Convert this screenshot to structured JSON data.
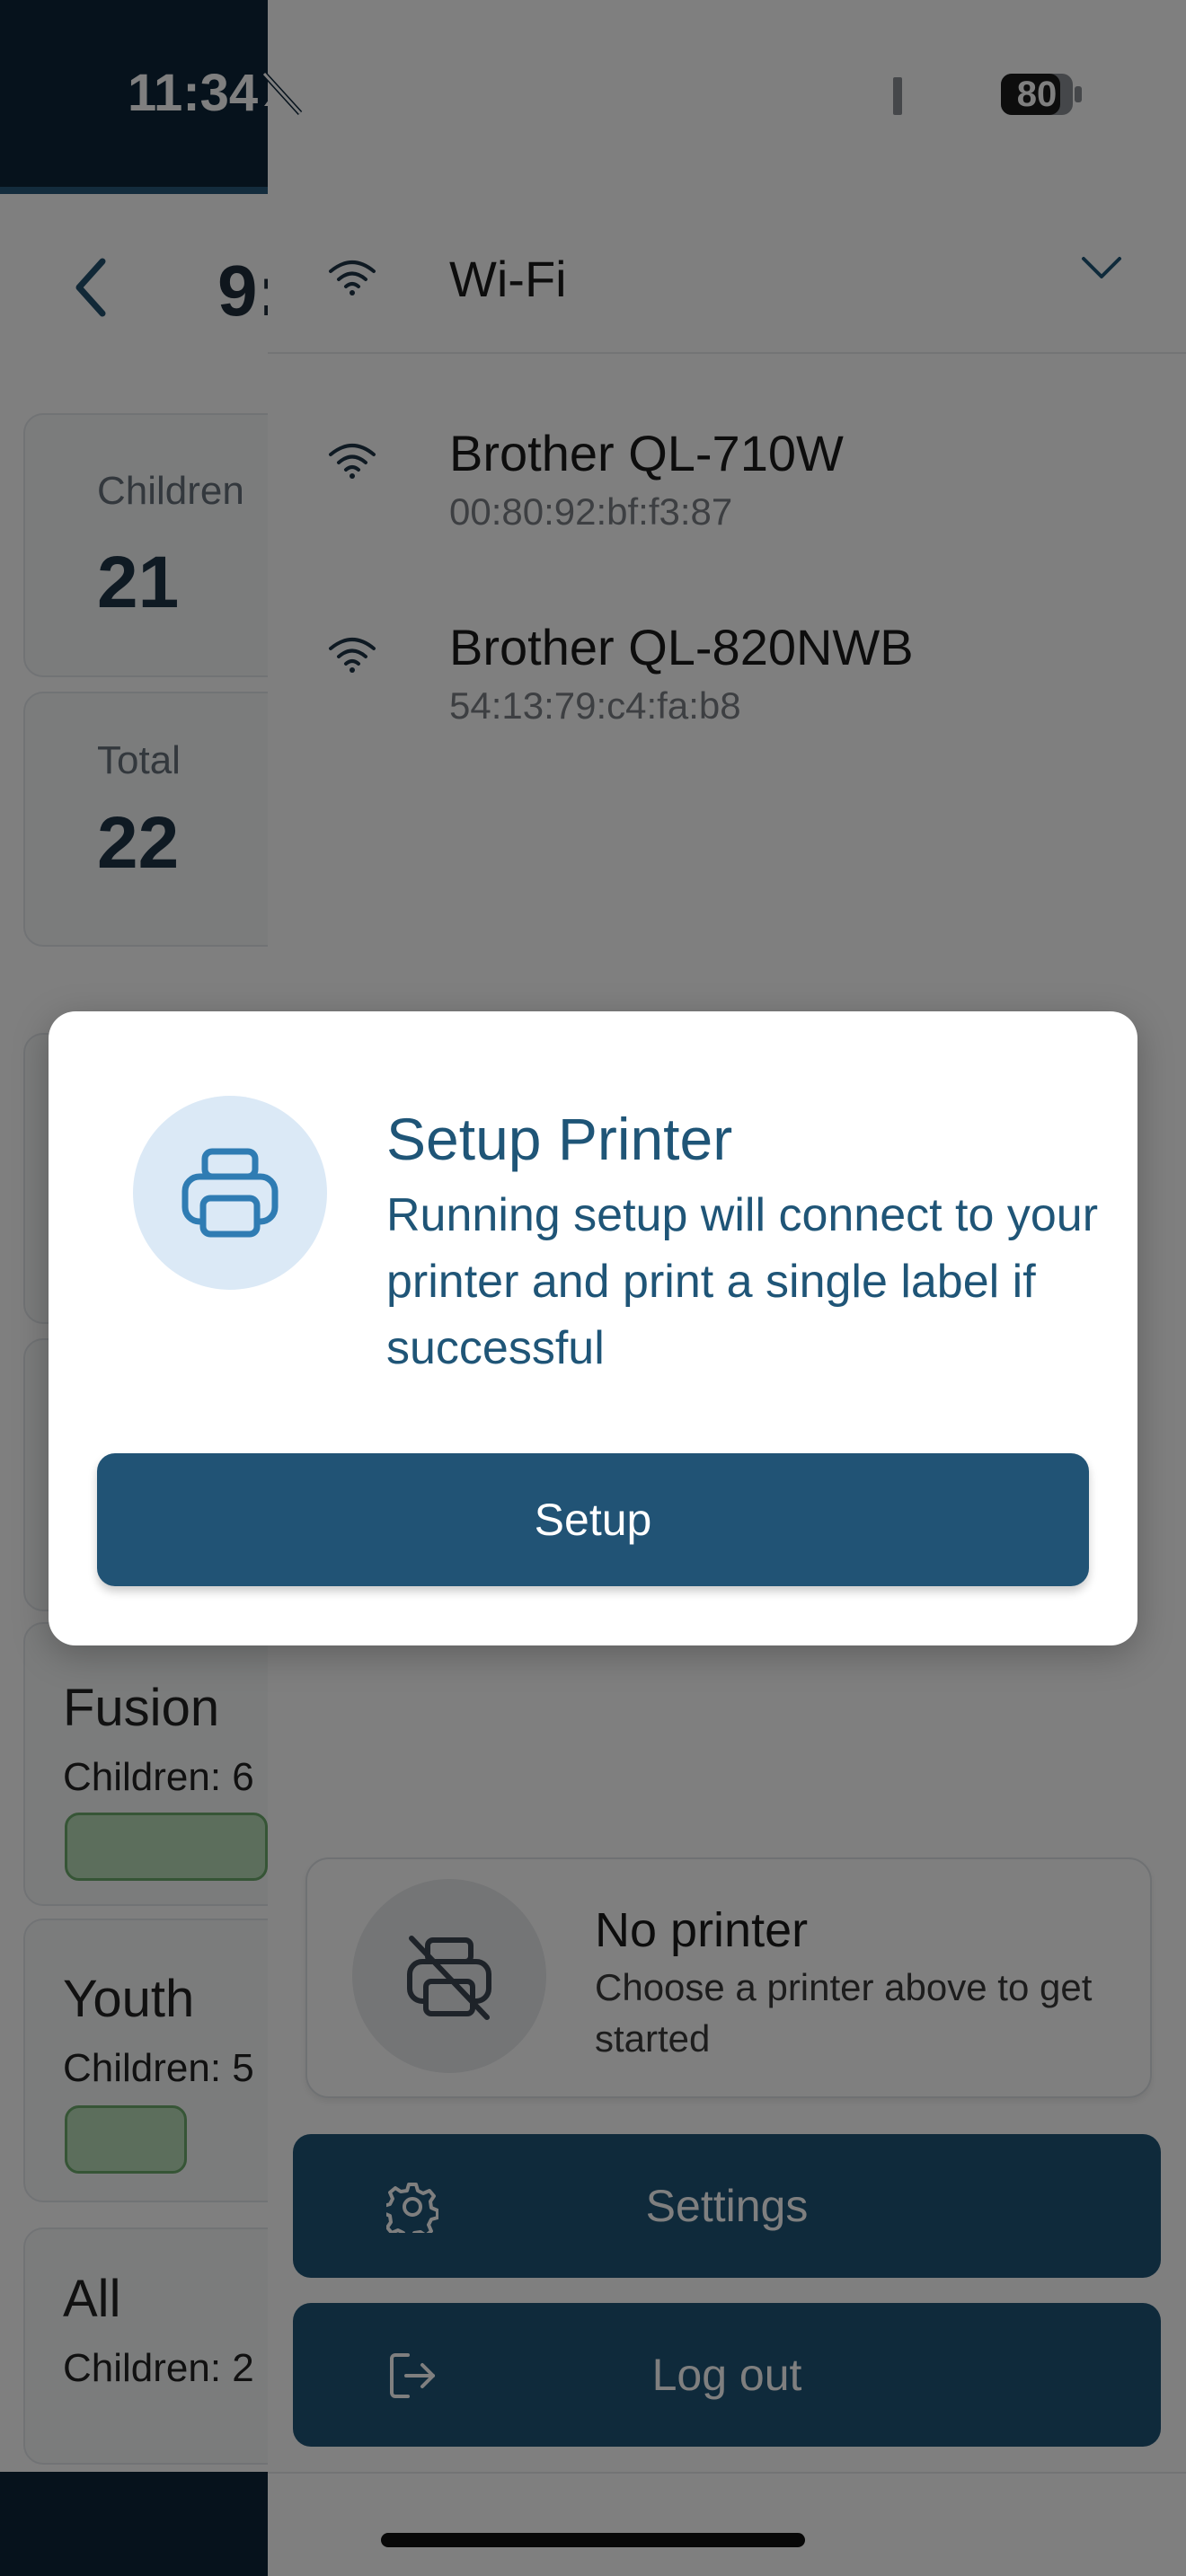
{
  "status_bar": {
    "time": "11:34",
    "battery": "80"
  },
  "background": {
    "title_partial": "9:",
    "cards": [
      {
        "label": "Children",
        "value": "21"
      },
      {
        "label": "Total",
        "value": "22"
      }
    ],
    "groups": [
      {
        "title": "Fusion",
        "subtitle": "Children: 6"
      },
      {
        "title": "Youth",
        "subtitle": "Children: 5"
      },
      {
        "title": "All",
        "subtitle": "Children: 2"
      }
    ]
  },
  "drawer": {
    "connection_label": "Wi-Fi",
    "printers": [
      {
        "name": "Brother QL-710W",
        "mac": "00:80:92:bf:f3:87"
      },
      {
        "name": "Brother QL-820NWB",
        "mac": "54:13:79:c4:fa:b8"
      }
    ],
    "no_printer": {
      "title": "No printer",
      "subtitle": "Choose a printer above to get started"
    },
    "settings_label": "Settings",
    "logout_label": "Log out"
  },
  "modal": {
    "title": "Setup Printer",
    "body": "Running setup will connect to your printer and print a single label if successful",
    "button_label": "Setup"
  },
  "colors": {
    "primary": "#215375",
    "dark_navy": "#0d2538",
    "icon_circle": "#dbe9f6"
  },
  "icons": {
    "status": [
      "bell-slash-icon",
      "cellular-signal-icon",
      "wifi-icon",
      "battery-icon"
    ],
    "drawer": [
      "wifi-icon",
      "chevron-down-icon",
      "printer-off-icon",
      "gear-icon",
      "logout-icon"
    ],
    "modal": [
      "printer-icon"
    ]
  }
}
